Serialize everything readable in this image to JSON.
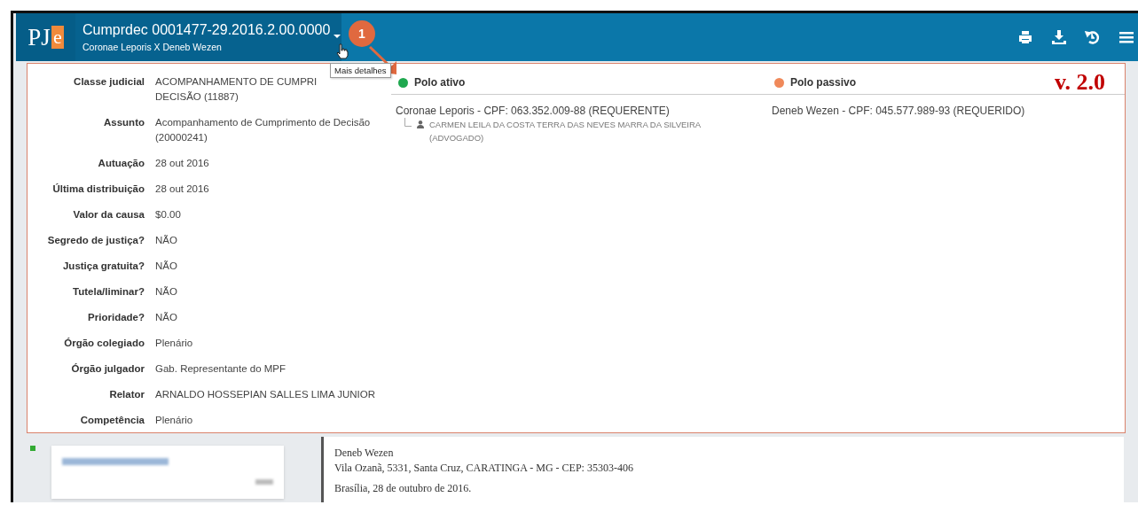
{
  "header": {
    "logo": {
      "main": "PJ",
      "accent": "e"
    },
    "case_number": "Cumprdec 0001477-29.2016.2.00.0000",
    "parties": "Coronae Leporis X Deneb Wezen",
    "callout_badge": "1",
    "tooltip": "Mais detalhes"
  },
  "version_label": "v. 2.0",
  "details": [
    {
      "label": "Classe judicial",
      "value": "ACOMPANHAMENTO DE CUMPRI",
      "value_continued": "DECISÃO (11887)"
    },
    {
      "label": "Assunto",
      "value": "Acompanhamento de Cumprimento de Decisão (20000241)"
    },
    {
      "label": "Autuação",
      "value": "28 out 2016"
    },
    {
      "label": "Última distribuição",
      "value": "28 out 2016"
    },
    {
      "label": "Valor da causa",
      "value": "$0.00"
    },
    {
      "label": "Segredo de justiça?",
      "value": "NÃO"
    },
    {
      "label": "Justiça gratuita?",
      "value": "NÃO"
    },
    {
      "label": "Tutela/liminar?",
      "value": "NÃO"
    },
    {
      "label": "Prioridade?",
      "value": "NÃO"
    },
    {
      "label": "Órgão colegiado",
      "value": "Plenário"
    },
    {
      "label": "Órgão julgador",
      "value": "Gab. Representante do MPF"
    },
    {
      "label": "Relator",
      "value": "ARNALDO HOSSEPIAN SALLES LIMA JUNIOR"
    },
    {
      "label": "Competência",
      "value": "Plenário"
    }
  ],
  "poles": [
    {
      "title": "Polo ativo",
      "color": "#1fa84f",
      "parties": [
        {
          "text": "Coronae Leporis - CPF: 063.352.009-88 (REQUERENTE)",
          "children": [
            {
              "text": "CARMEN LEILA DA COSTA TERRA DAS NEVES MARRA DA SILVEIRA (ADVOGADO)"
            }
          ]
        }
      ]
    },
    {
      "title": "Polo passivo",
      "color": "#f0895a",
      "parties": [
        {
          "text": "Deneb Wezen - CPF: 045.577.989-93 (REQUERIDO)"
        }
      ]
    }
  ],
  "document_preview": {
    "lines": [
      "Deneb Wezen",
      "Vila Ozanã, 5331, Santa Cruz, CARATINGA - MG - CEP: 35303-406",
      "Brasília, 28 de outubro de 2016."
    ]
  }
}
